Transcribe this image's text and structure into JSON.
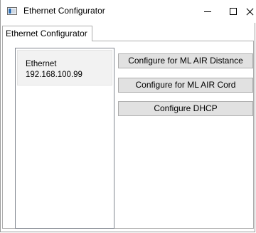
{
  "window": {
    "title": "Ethernet Configurator"
  },
  "tabs": [
    {
      "label": "Ethernet Configurator"
    }
  ],
  "adapters": [
    {
      "name": "Ethernet",
      "address": "192.168.100.99"
    }
  ],
  "buttons": {
    "configure_distance": "Configure for ML AIR Distance",
    "configure_cord": "Configure for ML AIR Cord",
    "configure_dhcp": "Configure DHCP"
  },
  "colors": {
    "button_face": "#e1e1e1",
    "selected_item": "#f2f2f2"
  },
  "icons": {
    "app": "app-window-icon",
    "minimize": "minimize-icon",
    "maximize": "maximize-icon",
    "close": "close-icon"
  }
}
